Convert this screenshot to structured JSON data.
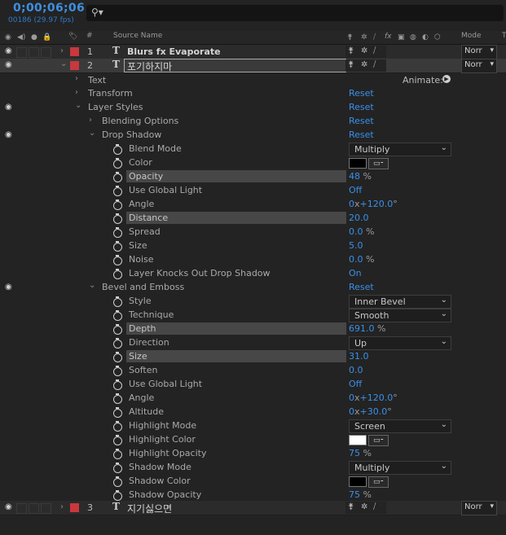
{
  "header": {
    "timecode": "0;00;06;06",
    "frames": "00186 (29.97 fps)",
    "search_icon": "search-icon"
  },
  "columns": {
    "number": "#",
    "source_name": "Source Name",
    "mode": "Mode",
    "track": "T"
  },
  "layers": [
    {
      "num": "1",
      "name": "Blurs fx Evaporate",
      "mode": "Norr"
    },
    {
      "num": "2",
      "name": "포기하지마",
      "mode": "Norr"
    },
    {
      "num": "3",
      "name": "지기싫으면",
      "mode": "Norr"
    }
  ],
  "props": {
    "text": "Text",
    "animate": "Animate:",
    "transform": "Transform",
    "transform_reset": "Reset",
    "layer_styles": "Layer Styles",
    "layer_styles_reset": "Reset",
    "blending": "Blending Options",
    "blending_reset": "Reset",
    "drop_shadow": "Drop Shadow",
    "drop_shadow_reset": "Reset",
    "ds_blend_mode": "Blend Mode",
    "ds_blend_mode_val": "Multiply",
    "ds_color": "Color",
    "ds_opacity": "Opacity",
    "ds_opacity_val": "48",
    "ds_angle": "Angle",
    "ds_angle_rev": "0",
    "ds_angle_deg": "+120.0",
    "ds_use_global": "Use Global Light",
    "ds_use_global_val": "Off",
    "ds_distance": "Distance",
    "ds_distance_val": "20.0",
    "ds_spread": "Spread",
    "ds_spread_val": "0.0",
    "ds_size": "Size",
    "ds_size_val": "5.0",
    "ds_noise": "Noise",
    "ds_noise_val": "0.0",
    "ds_knocks": "Layer Knocks Out Drop Shadow",
    "ds_knocks_val": "On",
    "bevel": "Bevel and Emboss",
    "bevel_reset": "Reset",
    "be_style": "Style",
    "be_style_val": "Inner Bevel",
    "be_technique": "Technique",
    "be_technique_val": "Smooth",
    "be_depth": "Depth",
    "be_depth_val": "691.0",
    "be_direction": "Direction",
    "be_direction_val": "Up",
    "be_size": "Size",
    "be_size_val": "31.0",
    "be_soften": "Soften",
    "be_soften_val": "0.0",
    "be_use_global": "Use Global Light",
    "be_use_global_val": "Off",
    "be_angle": "Angle",
    "be_angle_rev": "0",
    "be_angle_deg": "+120.0",
    "be_altitude": "Altitude",
    "be_altitude_rev": "0",
    "be_altitude_deg": "+30.0",
    "be_highlight_mode": "Highlight Mode",
    "be_highlight_mode_val": "Screen",
    "be_highlight_color": "Highlight Color",
    "be_highlight_opacity": "Highlight Opacity",
    "be_highlight_opacity_val": "75",
    "be_shadow_mode": "Shadow Mode",
    "be_shadow_mode_val": "Multiply",
    "be_shadow_color": "Shadow Color",
    "be_shadow_opacity": "Shadow Opacity",
    "be_shadow_opacity_val": "75"
  },
  "units": {
    "percent": "%",
    "x": "x",
    "deg": "°"
  },
  "colors": {
    "timecode": "#3d8fe0",
    "value_blue": "#3a90e8",
    "label_red": "#c8383c",
    "ds_color": "#000000",
    "highlight_color": "#ffffff",
    "shadow_color": "#000000"
  }
}
